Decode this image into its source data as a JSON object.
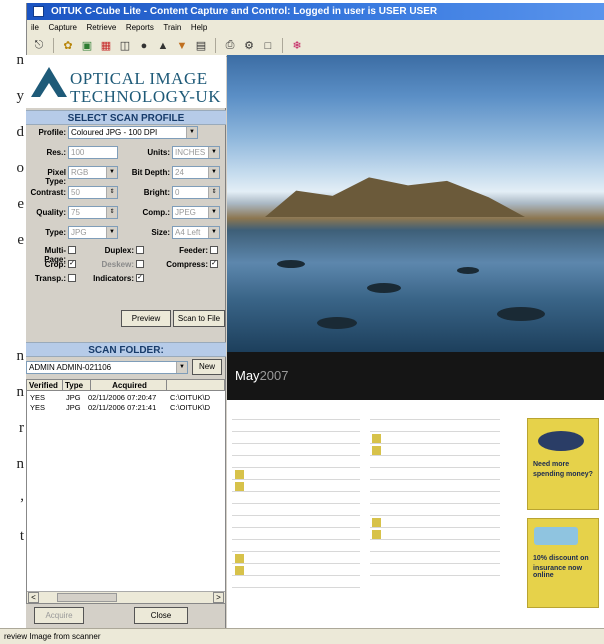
{
  "window": {
    "title": "OITUK C-Cube Lite - Content Capture and Control: Logged in user is USER USER"
  },
  "menu": {
    "items": [
      "ile",
      "Capture",
      "Retrieve",
      "Reports",
      "Train",
      "Help"
    ]
  },
  "toolbar": {
    "icons": [
      "scan-icon",
      "palette-icon",
      "folder-icon",
      "binoculars-icon",
      "bank-icon",
      "torch-icon",
      "book-icon",
      "print-icon",
      "config-icon",
      "window-icon",
      "help-icon"
    ]
  },
  "article_fragments": [
    "n",
    "y",
    "d",
    "o",
    "e",
    "e",
    "n",
    "n",
    "r",
    "n",
    ",",
    "t"
  ],
  "logo": {
    "line1": "OPTICAL IMAGE",
    "line2": "TECHNOLOGY-UK"
  },
  "scan_profile": {
    "header": "SELECT SCAN PROFILE",
    "profile_label": "Profile:",
    "profile_value": "Coloured JPG - 100 DPI",
    "res_label": "Res.:",
    "res_value": "100",
    "units_label": "Units:",
    "units_value": "INCHES",
    "pixel_type_label": "Pixel Type:",
    "pixel_type_value": "RGB",
    "bit_depth_label": "Bit Depth:",
    "bit_depth_value": "24",
    "contrast_label": "Contrast:",
    "contrast_value": "50",
    "bright_label": "Bright:",
    "bright_value": "0",
    "quality_label": "Quality:",
    "quality_value": "75",
    "comp_label": "Comp.:",
    "comp_value": "JPEG",
    "type_label": "Type:",
    "type_value": "JPG",
    "size_label": "Size:",
    "size_value": "A4 Left",
    "multipage_label": "Multi-Page:",
    "duplex_label": "Duplex:",
    "feeder_label": "Feeder:",
    "crop_label": "Crop:",
    "deskew_label": "Deskew:",
    "compress_label": "Compress:",
    "transp_label": "Transp.:",
    "indicators_label": "Indicators:",
    "check_mark": "✓",
    "preview_button": "Preview",
    "scan_to_file_button": "Scan to File"
  },
  "scan_folder": {
    "header": "SCAN FOLDER:",
    "folder_value": "ADMIN ADMIN-021106",
    "new_button": "New",
    "columns": [
      "Verified",
      "Type",
      "Acquired",
      ""
    ],
    "rows": [
      {
        "verified": "YES",
        "type": "JPG",
        "acquired": "02/11/2006 07:20:47",
        "path": "C:\\OITUK\\D"
      },
      {
        "verified": "YES",
        "type": "JPG",
        "acquired": "02/11/2006 07:21:41",
        "path": "C:\\OITUK\\D"
      }
    ],
    "scroll_left": "<",
    "scroll_right": ">",
    "acquire_button": "Acquire",
    "close_button": "Close"
  },
  "preview": {
    "month": "May",
    "year": "2007",
    "ad1_title": "Need more",
    "ad1_sub": "spending money?",
    "ad2_title": "10% discount on",
    "ad2_sub": "insurance now online"
  },
  "status": {
    "text": "review Image from scanner"
  }
}
